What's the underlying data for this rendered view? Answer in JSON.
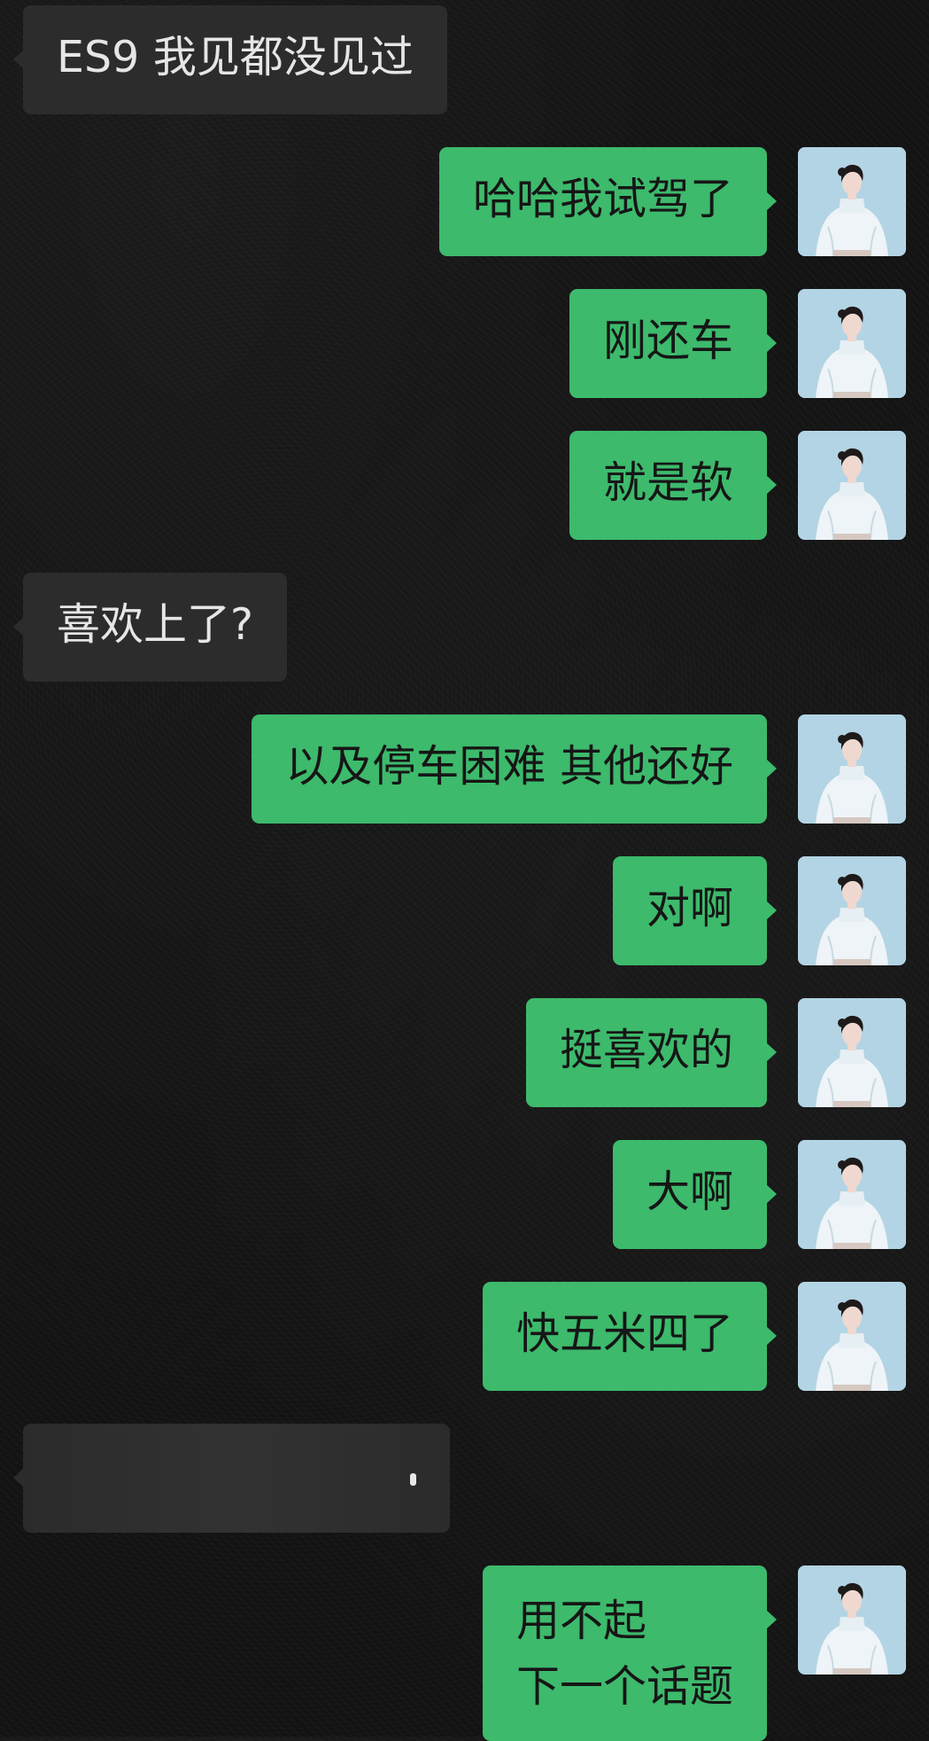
{
  "chat": {
    "messages": [
      {
        "side": "in",
        "text": "ES9 我见都没见过"
      },
      {
        "side": "out",
        "text": "哈哈我试驾了"
      },
      {
        "side": "out",
        "text": "刚还车"
      },
      {
        "side": "out",
        "text": "就是软"
      },
      {
        "side": "in",
        "text": "喜欢上了?"
      },
      {
        "side": "out",
        "text": "以及停车困难 其他还好"
      },
      {
        "side": "out",
        "text": "对啊"
      },
      {
        "side": "out",
        "text": "挺喜欢的"
      },
      {
        "side": "out",
        "text": "大啊"
      },
      {
        "side": "out",
        "text": "快五米四了"
      },
      {
        "side": "in",
        "text": ""
      },
      {
        "side": "out",
        "text": "用不起\n下一个话题"
      }
    ]
  },
  "colors": {
    "background": "#121212",
    "incoming_bubble": "#2c2c2c",
    "outgoing_bubble": "#3dba6c",
    "avatar_background": "#b8d6e6"
  },
  "icons": {
    "avatar": "user-avatar-icon"
  }
}
